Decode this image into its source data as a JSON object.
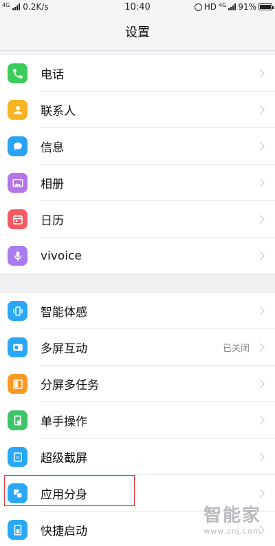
{
  "status_bar": {
    "network": "4G",
    "speed": "0.2K/s",
    "time": "10:40",
    "hd": "HD",
    "network2": "4G",
    "battery": "91%"
  },
  "header": {
    "title": "设置"
  },
  "group1": [
    {
      "label": "电话",
      "icon": "phone-icon",
      "color": "#3ccb5b"
    },
    {
      "label": "联系人",
      "icon": "contacts-icon",
      "color": "#f8b322"
    },
    {
      "label": "信息",
      "icon": "message-icon",
      "color": "#2aa3f5"
    },
    {
      "label": "相册",
      "icon": "gallery-icon",
      "color": "#b674ea"
    },
    {
      "label": "日历",
      "icon": "calendar-icon",
      "color": "#f25b63"
    },
    {
      "label": "vivoice",
      "icon": "microphone-icon",
      "color": "#a97cf0"
    }
  ],
  "group2": [
    {
      "label": "智能体感",
      "icon": "motion-icon",
      "color": "#2aa7f7"
    },
    {
      "label": "多屏互动",
      "value": "已关闭",
      "icon": "multiscreen-icon",
      "color": "#2aa7f7"
    },
    {
      "label": "分屏多任务",
      "icon": "split-screen-icon",
      "color": "#f89a26"
    },
    {
      "label": "单手操作",
      "icon": "one-hand-icon",
      "color": "#3dc667"
    },
    {
      "label": "超级截屏",
      "icon": "screenshot-icon",
      "color": "#2aa7f7"
    },
    {
      "label": "应用分身",
      "icon": "app-clone-icon",
      "color": "#2aa7f7"
    },
    {
      "label": "快捷启动",
      "icon": "quick-launch-icon",
      "color": "#2aa7f7"
    }
  ],
  "watermark": {
    "main": "智能家",
    "sub": "www.znj.com"
  }
}
